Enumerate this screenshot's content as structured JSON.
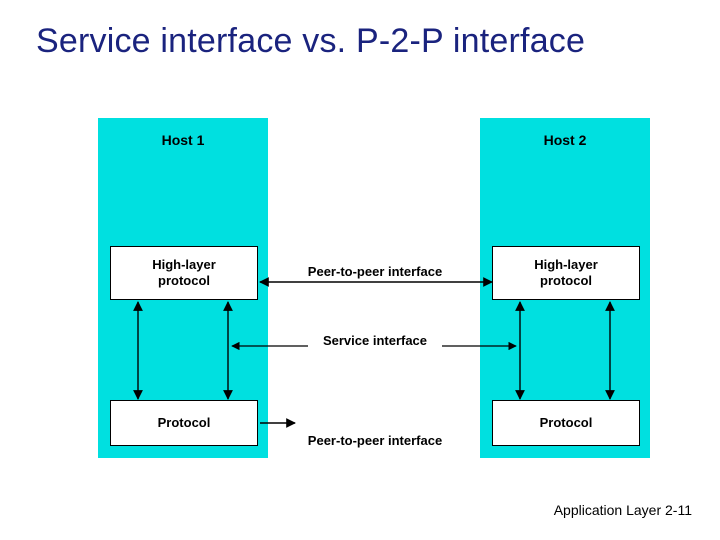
{
  "title": "Service interface vs. P-2-P interface",
  "hosts": {
    "h1": {
      "label": "Host 1"
    },
    "h2": {
      "label": "Host 2"
    }
  },
  "boxes": {
    "high_layer": {
      "line1": "High-layer",
      "line2": "protocol"
    },
    "protocol": {
      "label": "Protocol"
    }
  },
  "labels": {
    "p2p": "Peer-to-peer interface",
    "service": "Service interface"
  },
  "footer": {
    "section": "Application Layer",
    "page": "2-11"
  }
}
